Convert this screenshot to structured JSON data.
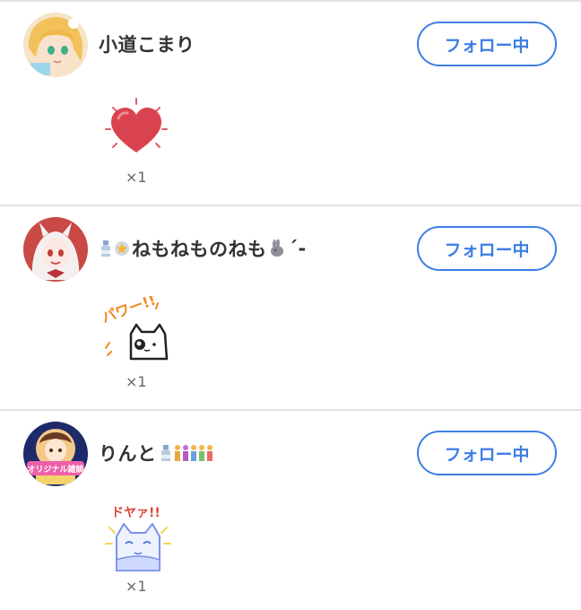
{
  "follow_label": "フォロー中",
  "accent_color": "#3d7ee6",
  "entries": [
    {
      "name": "小道こまり",
      "name_deco": [],
      "avatar": "anime-girl-blonde-avatar",
      "sticker": "heart-sticker",
      "count": "×1"
    },
    {
      "name": "ねもねものねも",
      "name_prefix_deco": [
        "sake-bottle-icon",
        "star-icon"
      ],
      "name_suffix_deco": [
        "rabbit-icon"
      ],
      "name_suffix_text": "´-",
      "avatar": "anime-girl-red-background-avatar",
      "sticker": "power-cat-sticker",
      "sticker_text": "パワー!!",
      "count": "×1"
    },
    {
      "name": "りんと",
      "name_suffix_deco": [
        "sake-bottle-icon",
        "people-icons"
      ],
      "avatar": "original-talk-banner-avatar",
      "avatar_text": "オリジナル雑談",
      "sticker": "doya-cat-sticker",
      "sticker_text": "ドヤァ!!",
      "count": "×1"
    }
  ]
}
